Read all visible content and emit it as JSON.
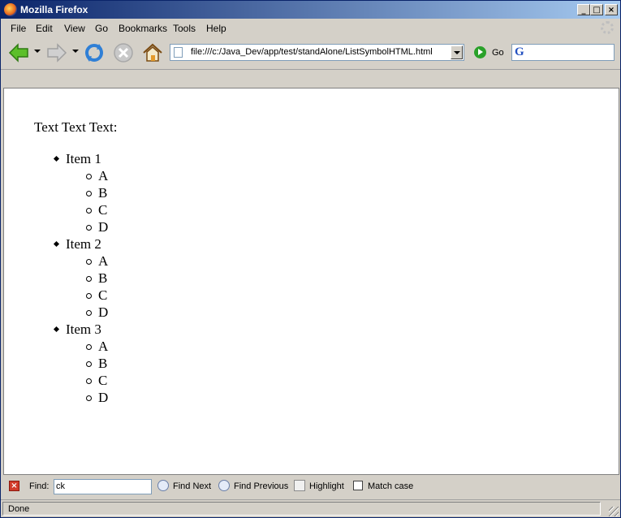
{
  "window": {
    "title": "Mozilla Firefox"
  },
  "menu": [
    "File",
    "Edit",
    "View",
    "Go",
    "Bookmarks",
    "Tools",
    "Help"
  ],
  "toolbar": {
    "url": "file:///c:/Java_Dev/app/test/standAlone/ListSymbolHTML.html",
    "go_label": "Go",
    "search_engine": "G"
  },
  "page": {
    "intro": "Text Text Text:",
    "items": [
      {
        "label": "Item 1",
        "children": [
          "A",
          "B",
          "C",
          "D"
        ]
      },
      {
        "label": "Item 2",
        "children": [
          "A",
          "B",
          "C",
          "D"
        ]
      },
      {
        "label": "Item 3",
        "children": [
          "A",
          "B",
          "C",
          "D"
        ]
      }
    ]
  },
  "findbar": {
    "label": "Find:",
    "value": "ck",
    "next": "Find Next",
    "previous": "Find Previous",
    "highlight": "Highlight",
    "match_case": "Match case"
  },
  "status": {
    "text": "Done"
  }
}
